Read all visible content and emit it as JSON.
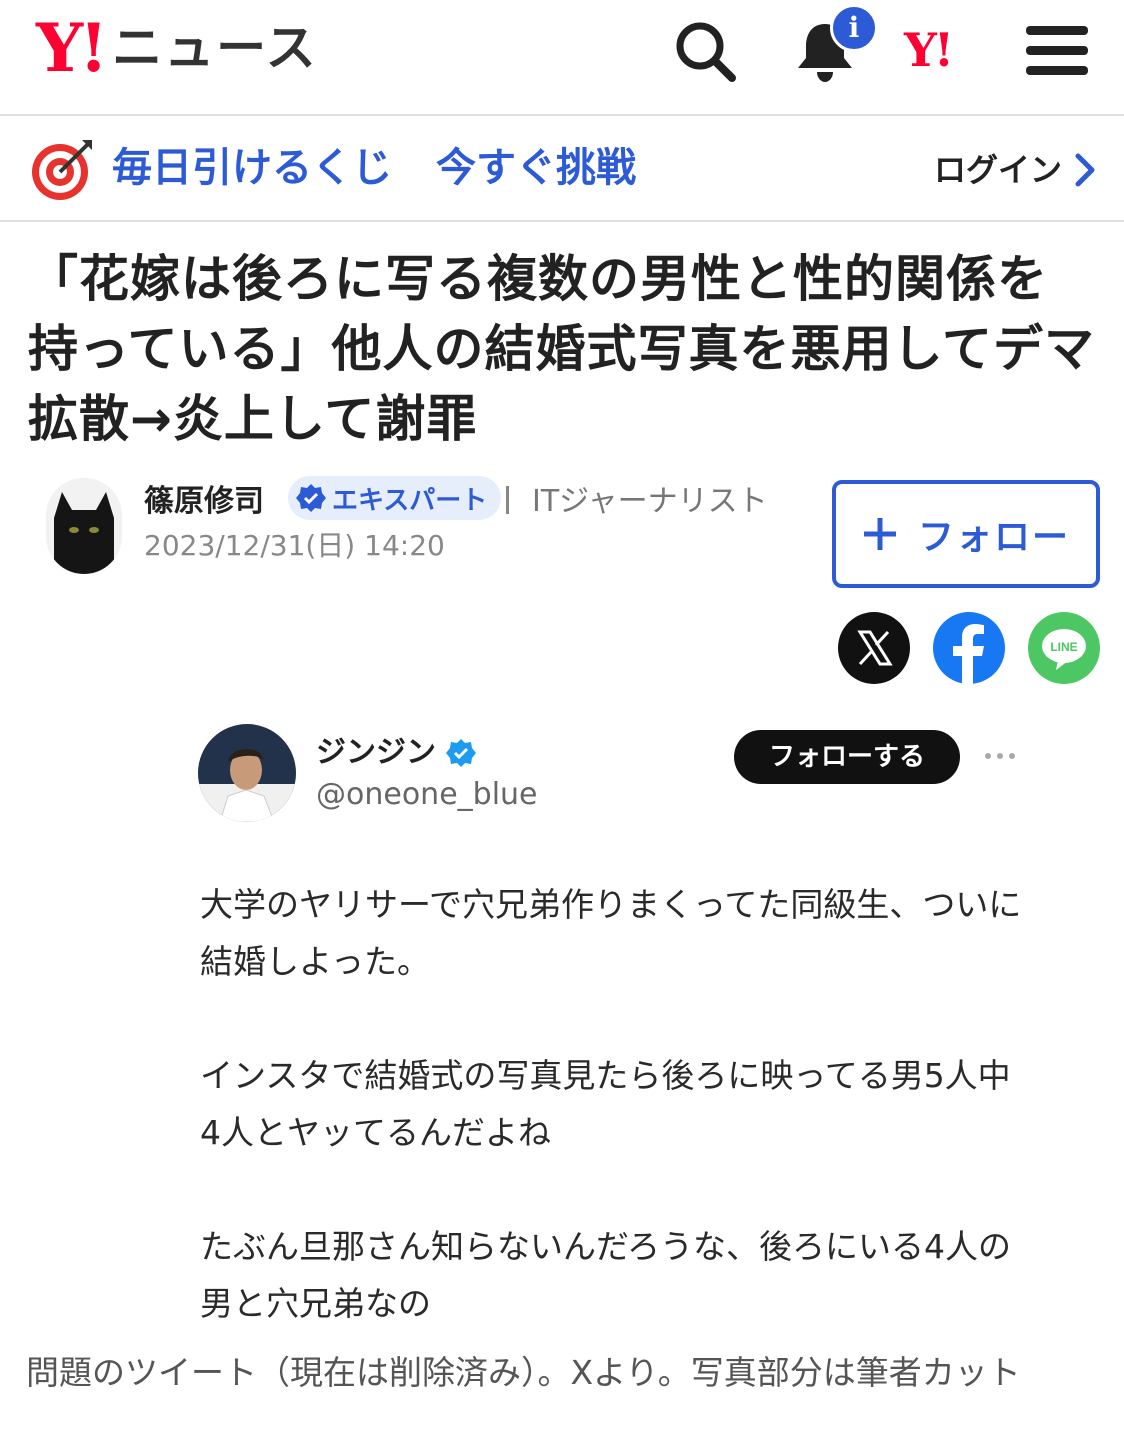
{
  "header": {
    "logo_y": "Y!",
    "logo_text": "ニュース",
    "notification_badge": "i",
    "yahoo_link": "Y!"
  },
  "promo": {
    "lottery_label": "毎日引けるくじ",
    "challenge_label": "今すぐ挑戦",
    "login_label": "ログイン"
  },
  "article": {
    "title": "「花嫁は後ろに写る複数の男性と性的関係を持っている」他人の結婚式写真を悪用してデマ拡散→炎上して謝罪",
    "author": {
      "name": "篠原修司",
      "badge": "エキスパート",
      "role": "ITジャーナリスト",
      "date": "2023/12/31(日) 14:20",
      "follow_label": "フォロー"
    },
    "share": [
      "x-icon",
      "facebook-icon",
      "line-icon"
    ],
    "line_label": "LINE"
  },
  "tweet": {
    "name": "ジンジン",
    "handle": "@oneone_blue",
    "follow_label": "フォローする",
    "paragraphs": [
      "大学のヤリサーで穴兄弟作りまくってた同級生、ついに結婚しよった。",
      "インスタで結婚式の写真見たら後ろに映ってる男5人中4人とヤッてるんだよね",
      "たぶん旦那さん知らないんだろうな、後ろにいる4人の男と穴兄弟なの"
    ]
  },
  "caption": "問題のツイート（現在は削除済み）。Xより。写真部分は筆者カット",
  "colors": {
    "brand_red": "#ff0033",
    "accent_blue": "#2d5bd6",
    "facebook": "#1877f2",
    "line": "#4cc764"
  }
}
